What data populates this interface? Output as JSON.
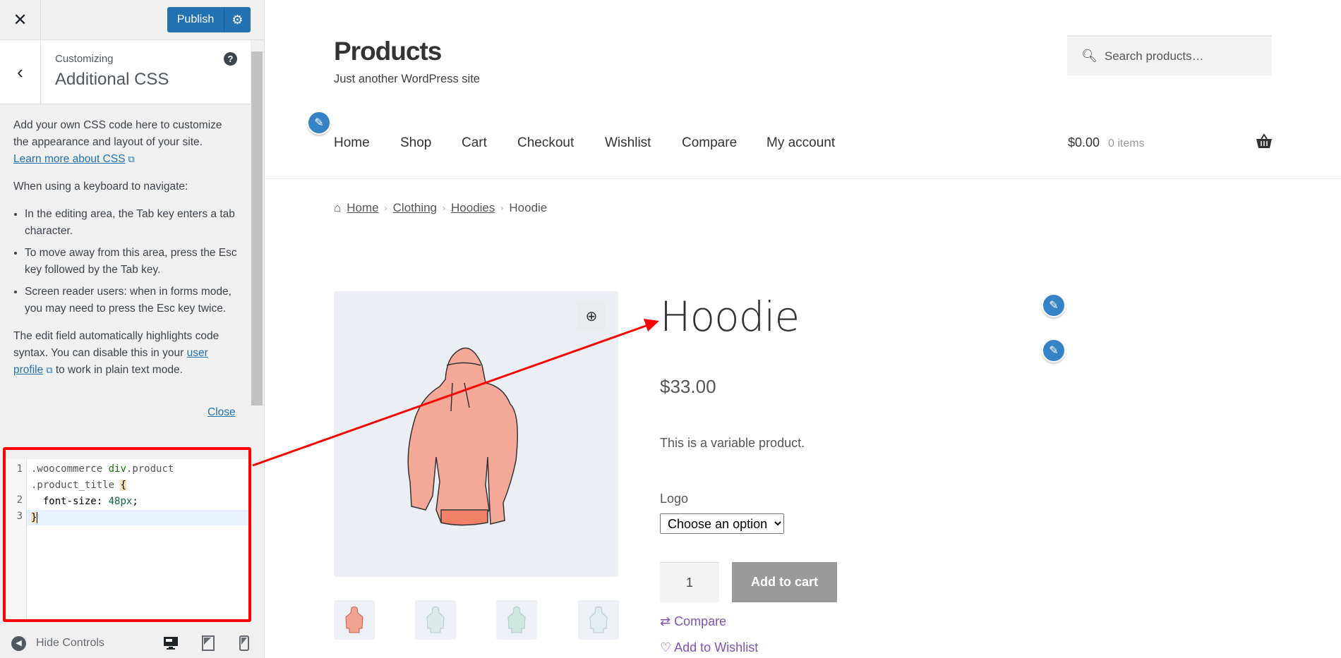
{
  "customizer": {
    "close_icon": "close-icon",
    "publish_label": "Publish",
    "settings_icon": "gear-icon",
    "back_icon": "chevron-left-icon",
    "breadcrumb_label": "Customizing",
    "section_title": "Additional CSS",
    "help_icon": "question-icon",
    "intro": "Add your own CSS code here to customize the appearance and layout of your site.",
    "learn_more_link": "Learn more about CSS",
    "keyboard_heading": "When using a keyboard to navigate:",
    "tips": [
      "In the editing area, the Tab key enters a tab character.",
      "To move away from this area, press the Esc key followed by the Tab key.",
      "Screen reader users: when in forms mode, you may need to press the Esc key twice."
    ],
    "syntax_note_before": "The edit field automatically highlights code syntax. You can disable this in your",
    "user_profile_link": "user profile",
    "syntax_note_after": "to work in plain text mode.",
    "close_link": "Close",
    "code": {
      "line_numbers": [
        "1",
        "2",
        "3"
      ],
      "line1a": ".woocommerce",
      "line1b": "div",
      "line1c": ".product",
      "line1d": ".product_title",
      "line1e": "{",
      "line2a": "font-size",
      "line2b": ":",
      "line2c": "48px",
      "line2d": ";",
      "line3": "}"
    },
    "footer": {
      "hide_controls": "Hide Controls",
      "devices": [
        "desktop",
        "tablet",
        "mobile"
      ]
    }
  },
  "site": {
    "title": "Products",
    "tagline": "Just another WordPress site",
    "search_placeholder": "Search products…",
    "nav": [
      "Home",
      "Shop",
      "Cart",
      "Checkout",
      "Wishlist",
      "Compare",
      "My account"
    ],
    "cart_amount": "$0.00",
    "cart_items": "0 items"
  },
  "breadcrumb": [
    "Home",
    "Clothing",
    "Hoodies",
    "Hoodie"
  ],
  "product": {
    "title": "Hoodie",
    "price": "$33.00",
    "description": "This is a variable product.",
    "attribute_label": "Logo",
    "attribute_selected": "Choose an option",
    "quantity": "1",
    "add_to_cart": "Add to cart",
    "compare": "Compare",
    "wishlist": "Add to Wishlist",
    "thumbnail_colors": [
      "#f2a290",
      "#dfe9ea",
      "#cfe6de",
      "#e3ecef"
    ]
  },
  "colors": {
    "publish": "#2271b1",
    "annotation": "#ff0000",
    "link_purple": "#7f54b3",
    "edit_shortcut": "#3582c4"
  }
}
